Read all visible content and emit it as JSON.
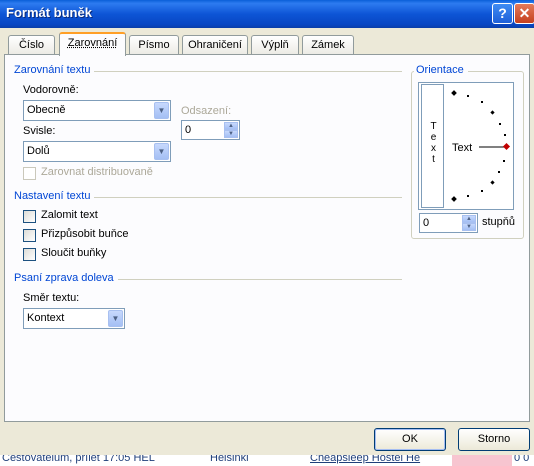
{
  "window": {
    "title": "Formát buněk"
  },
  "tabs": [
    {
      "label": "Číslo"
    },
    {
      "label": "Zarovnání"
    },
    {
      "label": "Písmo"
    },
    {
      "label": "Ohraničení"
    },
    {
      "label": "Výplň"
    },
    {
      "label": "Zámek"
    }
  ],
  "text_alignment": {
    "heading": "Zarovnání textu",
    "horizontal_label": "Vodorovně:",
    "horizontal_value": "Obecně",
    "vertical_label": "Svisle:",
    "vertical_value": "Dolů",
    "indent_label": "Odsazení:",
    "indent_value": "0",
    "distributed_label": "Zarovnat distribuovaně"
  },
  "text_control": {
    "heading": "Nastavení textu",
    "wrap_label": "Zalomit text",
    "shrink_label": "Přizpůsobit buňce",
    "merge_label": "Sloučit buňky"
  },
  "rtl": {
    "heading": "Psaní zprava doleva",
    "direction_label": "Směr textu:",
    "direction_value": "Kontext"
  },
  "orientation": {
    "heading": "Orientace",
    "vertical_letters": [
      "T",
      "e",
      "x",
      "t"
    ],
    "dial_label": "Text",
    "degrees_value": "0",
    "degrees_label": "stupňů"
  },
  "buttons": {
    "ok": "OK",
    "cancel": "Storno"
  },
  "background": {
    "text_left": "Cestovatelům, přílet 17:05 HEL",
    "text_mid": "Helsinki",
    "text_right": "Cheapsleep Hostel He",
    "text_far": "0 0"
  }
}
